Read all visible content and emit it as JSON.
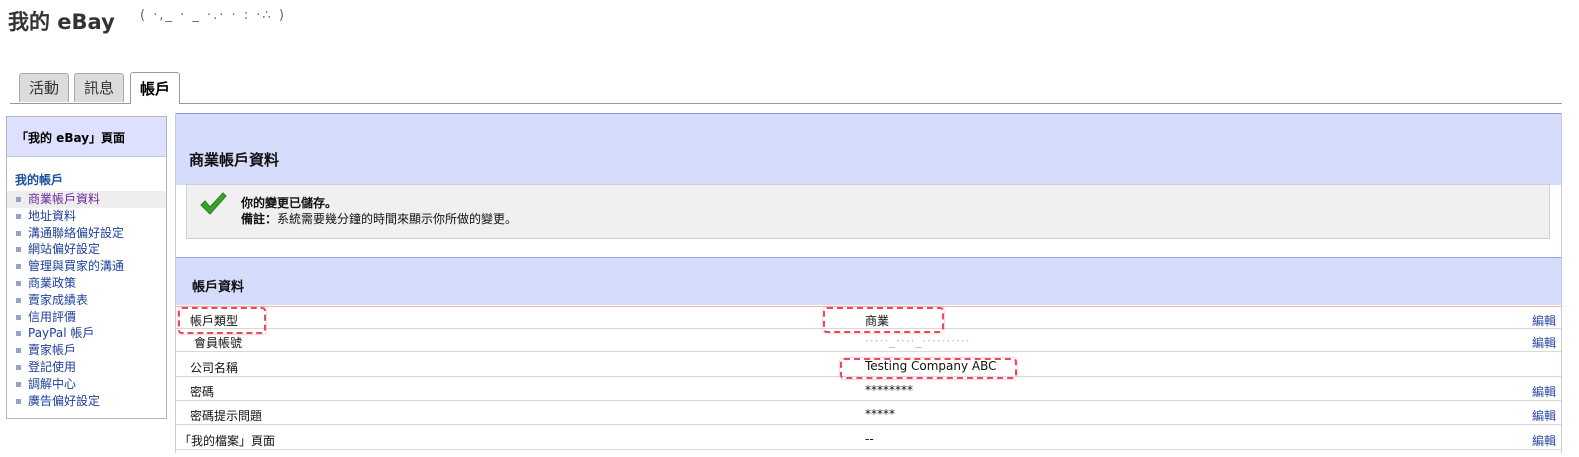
{
  "header": {
    "title": "我的 eBay",
    "username_masked": "( ·,_ · _ ·.· · : ·∴ )"
  },
  "tabs": [
    {
      "label": "活動"
    },
    {
      "label": "訊息"
    },
    {
      "label": "帳戶"
    }
  ],
  "sidebar": {
    "heading": "「我的 eBay」頁面",
    "section": "我的帳戶",
    "items": [
      {
        "label": "商業帳戶資料"
      },
      {
        "label": "地址資料"
      },
      {
        "label": "溝通聯絡偏好設定"
      },
      {
        "label": "網站偏好設定"
      },
      {
        "label": "管理與買家的溝通"
      },
      {
        "label": "商業政策"
      },
      {
        "label": "賣家成績表"
      },
      {
        "label": "信用評價"
      },
      {
        "label": "PayPal 帳戶"
      },
      {
        "label": "賣家帳戶"
      },
      {
        "label": "登記使用"
      },
      {
        "label": "調解中心"
      },
      {
        "label": "廣告偏好設定"
      }
    ]
  },
  "main": {
    "title": "商業帳戶資料",
    "notice": {
      "title": "你的變更已儲存。",
      "note_label": "備註：",
      "note_text": "系統需要幾分鐘的時間來顯示你所做的變更。"
    },
    "section_title": "帳戶資料",
    "rows": [
      {
        "label": "帳戶類型",
        "value": "商業",
        "edit": "編輯"
      },
      {
        "label": "會員帳號",
        "value": "·····_····_··········",
        "edit": "編輯"
      },
      {
        "label": "公司名稱",
        "value": "Testing Company ABC",
        "edit": ""
      },
      {
        "label": "密碼",
        "value": "********",
        "edit": "編輯"
      },
      {
        "label": "密碼提示問題",
        "value": "*****",
        "edit": "編輯"
      },
      {
        "label": "「我的檔案」頁面",
        "value": "--",
        "edit": "編輯"
      }
    ]
  },
  "colors": {
    "band": "#d6dcfb",
    "highlight": "#e84a5f",
    "link": "#2c4aa8",
    "check": "#3aa12c"
  },
  "icons": [
    "checkmark-icon",
    "bullet-icon"
  ]
}
